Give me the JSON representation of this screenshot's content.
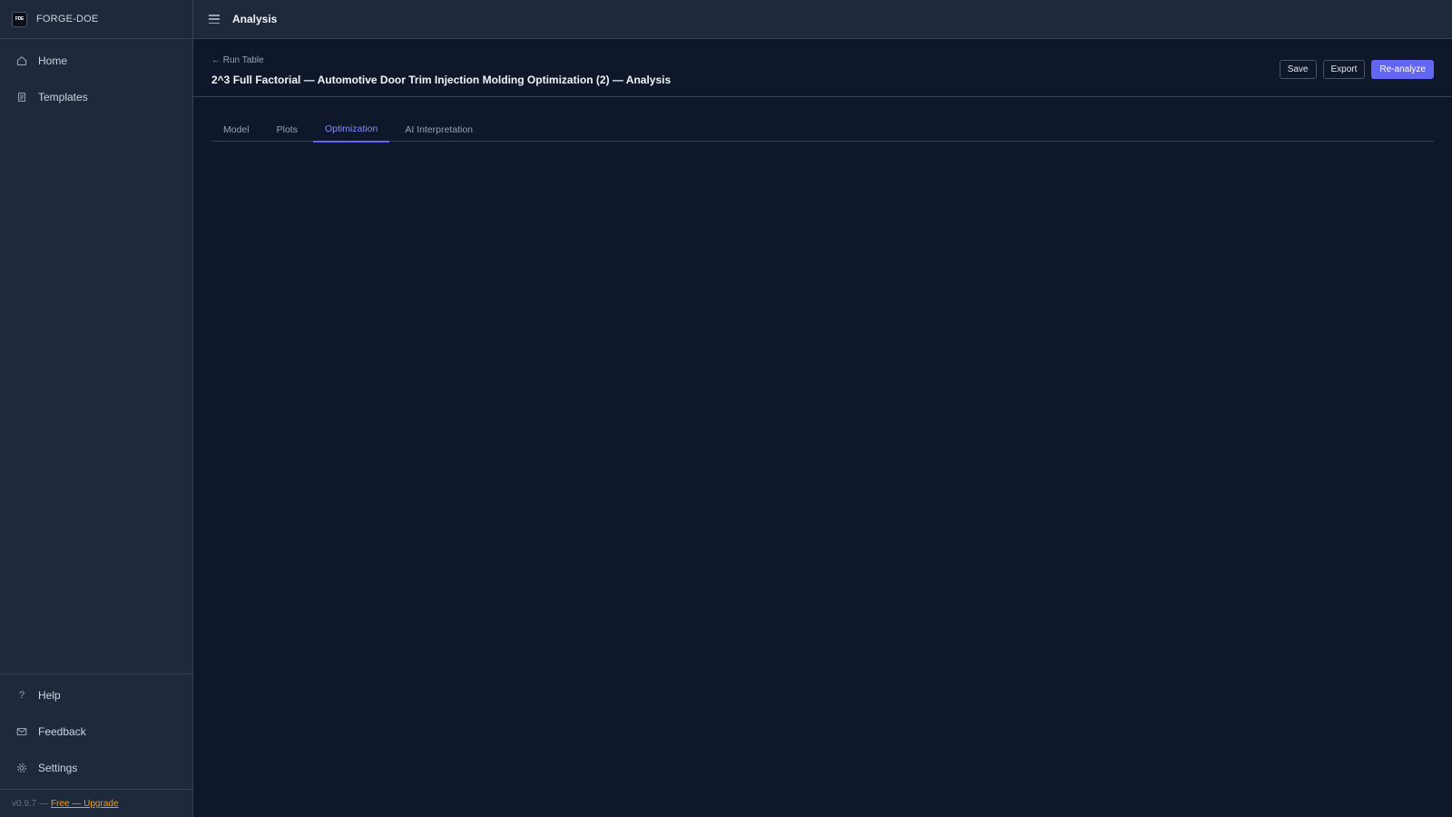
{
  "brand": {
    "logo_text": "FDE",
    "name": "FORGE-DOE"
  },
  "sidebar": {
    "items": [
      {
        "label": "Home",
        "icon": "home-icon"
      },
      {
        "label": "Templates",
        "icon": "document-icon"
      }
    ],
    "bottom_items": [
      {
        "label": "Help",
        "icon": "help-icon"
      },
      {
        "label": "Feedback",
        "icon": "mail-icon"
      },
      {
        "label": "Settings",
        "icon": "gear-icon"
      }
    ],
    "footer": {
      "version": "v0.9.7 —",
      "plan_link": "Free — Upgrade"
    }
  },
  "topbar": {
    "title": "Analysis"
  },
  "header": {
    "back_label": "← Run Table",
    "title": "2^3 Full Factorial — Automotive Door Trim Injection Molding Optimization (2) — Analysis"
  },
  "actions": {
    "save": "Save",
    "export": "Export",
    "reanalyze": "Re-analyze"
  },
  "tabs": [
    {
      "label": "Model",
      "active": false
    },
    {
      "label": "Plots",
      "active": false
    },
    {
      "label": "Optimization",
      "active": true
    },
    {
      "label": "AI Interpretation",
      "active": false
    }
  ],
  "colors": {
    "background": "#0f172a",
    "panel": "#1e293b",
    "accent": "#6366f1",
    "upgrade_link": "#f59e0b"
  }
}
